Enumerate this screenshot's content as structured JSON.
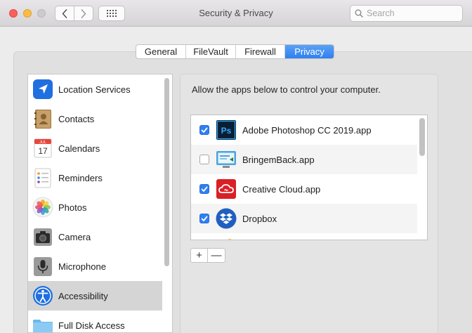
{
  "window": {
    "title": "Security & Privacy"
  },
  "toolbar": {
    "search_placeholder": "Search"
  },
  "tabs": [
    {
      "label": "General",
      "active": false
    },
    {
      "label": "FileVault",
      "active": false
    },
    {
      "label": "Firewall",
      "active": false
    },
    {
      "label": "Privacy",
      "active": true
    }
  ],
  "sidebar": {
    "items": [
      {
        "label": "Location Services",
        "icon": "location-arrow-icon"
      },
      {
        "label": "Contacts",
        "icon": "contacts-book-icon"
      },
      {
        "label": "Calendars",
        "icon": "calendar-icon",
        "badge_month": "JUL",
        "badge_day": "17"
      },
      {
        "label": "Reminders",
        "icon": "reminders-list-icon"
      },
      {
        "label": "Photos",
        "icon": "photos-flower-icon"
      },
      {
        "label": "Camera",
        "icon": "camera-icon"
      },
      {
        "label": "Microphone",
        "icon": "microphone-icon"
      },
      {
        "label": "Accessibility",
        "icon": "accessibility-icon",
        "selected": true
      },
      {
        "label": "Full Disk Access",
        "icon": "folder-icon"
      }
    ]
  },
  "main": {
    "instructions": "Allow the apps below to control your computer.",
    "apps": [
      {
        "name": "Adobe Photoshop CC 2019.app",
        "checked": true,
        "icon": "photoshop-icon",
        "icon_text": "Ps"
      },
      {
        "name": "BringemBack.app",
        "checked": false,
        "icon": "bringemback-icon"
      },
      {
        "name": "Creative Cloud.app",
        "checked": true,
        "icon": "creative-cloud-icon"
      },
      {
        "name": "Dropbox",
        "checked": true,
        "icon": "dropbox-icon"
      }
    ],
    "add_label": "+",
    "remove_label": "—"
  },
  "colors": {
    "accent": "#2f7ff0",
    "selected_row": "#d5d5d5"
  }
}
